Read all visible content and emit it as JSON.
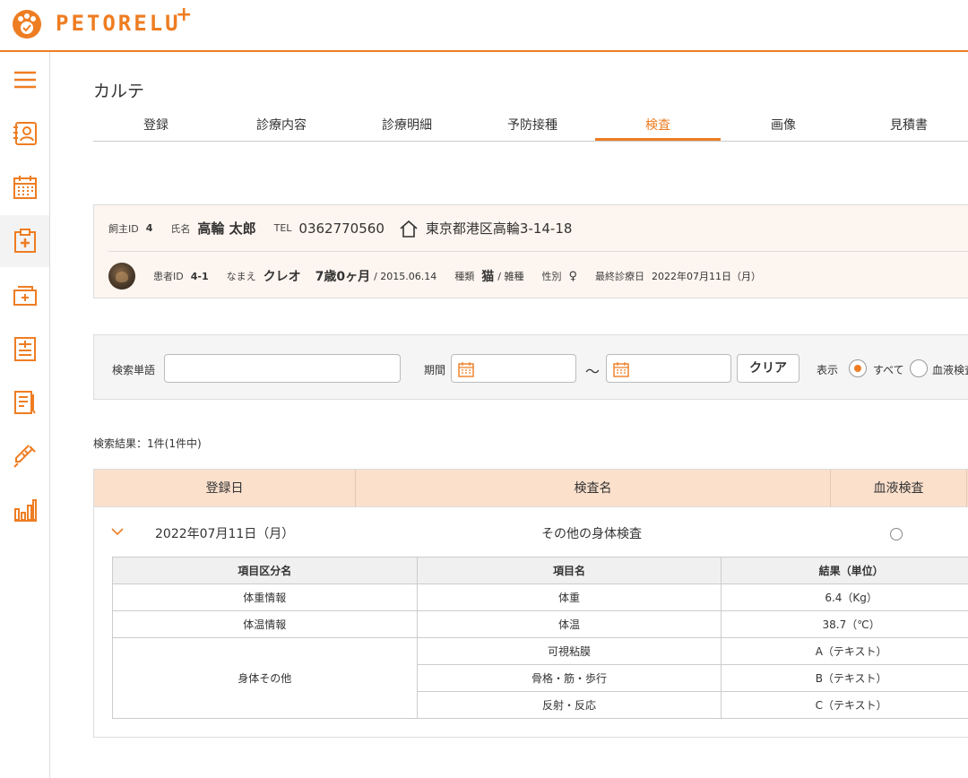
{
  "app": {
    "logo_text": "PETORELU",
    "logo_plus": "+"
  },
  "sidebar": {
    "items": [
      {
        "name": "menu"
      },
      {
        "name": "owner-card"
      },
      {
        "name": "calendar"
      },
      {
        "name": "medical-record",
        "active": true
      },
      {
        "name": "register"
      },
      {
        "name": "list"
      },
      {
        "name": "document"
      },
      {
        "name": "syringe"
      },
      {
        "name": "chart"
      }
    ]
  },
  "page": {
    "title": "カルテ"
  },
  "tabs": [
    {
      "label": "登録"
    },
    {
      "label": "診療内容"
    },
    {
      "label": "診療明細"
    },
    {
      "label": "予防接種"
    },
    {
      "label": "検査",
      "active": true
    },
    {
      "label": "画像"
    },
    {
      "label": "見積書"
    }
  ],
  "owner": {
    "id_label": "飼主ID",
    "id": "4",
    "name_label": "氏名",
    "name": "高輪 太郎",
    "tel_label": "TEL",
    "tel": "0362770560",
    "address": "東京都港区高輪3-14-18"
  },
  "patient": {
    "id_label": "患者ID",
    "id": "4-1",
    "name_label": "なまえ",
    "name": "クレオ",
    "age": "7歳0ヶ月",
    "birth": "/ 2015.06.14",
    "species_label": "種類",
    "species": "猫",
    "breed": "/ 雑種",
    "sex_label": "性別",
    "sex": "♀",
    "last_visit_label": "最終診療日",
    "last_visit": "2022年07月11日（月）"
  },
  "search": {
    "keyword_label": "検索単語",
    "keyword_value": "",
    "period_label": "期間",
    "period_from": "",
    "period_to": "",
    "tilde": "～",
    "clear_label": "クリア",
    "display_label": "表示",
    "option_all": "すべて",
    "option_blood": "血液検査"
  },
  "result_count": "検索結果：1件(1件中)",
  "results": {
    "headers": [
      "登録日",
      "検査名",
      "血液検査"
    ],
    "rows": [
      {
        "date": "2022年07月11日（月）",
        "name": "その他の身体検査",
        "sub_headers": [
          "項目区分名",
          "項目名",
          "結果（単位）"
        ],
        "sub_rows": [
          {
            "category": "体重情報",
            "item": "体重",
            "result": "6.4（Kg）"
          },
          {
            "category": "体温情報",
            "item": "体温",
            "result": "38.7（℃）"
          },
          {
            "category": "身体その他",
            "item": "可視粘膜",
            "result": "A（テキスト）"
          },
          {
            "category": "",
            "item": "骨格・筋・歩行",
            "result": "B（テキスト）"
          },
          {
            "category": "",
            "item": "反射・反応",
            "result": "C（テキスト）"
          }
        ]
      }
    ]
  },
  "colors": {
    "accent": "#ee7d22",
    "header_bg": "#fbe0cc",
    "card_bg": "#fdf5ef"
  }
}
